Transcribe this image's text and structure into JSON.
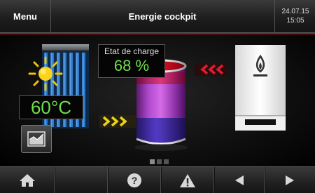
{
  "header": {
    "menu_label": "Menu",
    "title": "Energie cockpit",
    "date": "24.07.15",
    "time": "15:05"
  },
  "solar": {
    "temperature": "60°C"
  },
  "storage": {
    "charge_label": "Etat de charge",
    "charge_value": "68 %"
  },
  "page_indicator": {
    "pages": 3,
    "active": 0
  },
  "footer": {
    "buttons": [
      "home-icon",
      "help-icon",
      "warning-icon",
      "back-icon",
      "forward-icon"
    ]
  },
  "colors": {
    "accent_red": "#b10e16",
    "value_green": "#6fdf4a",
    "flow_yellow": "#e8d21a",
    "flow_red": "#d42030"
  }
}
